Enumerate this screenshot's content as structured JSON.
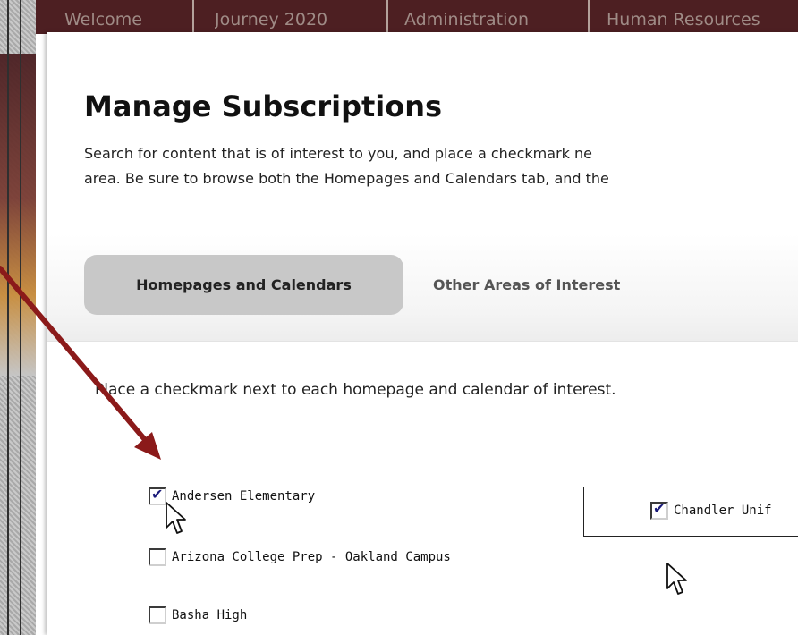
{
  "background_tabs": [
    "Welcome",
    "Journey 2020",
    "Administration",
    "Human Resources"
  ],
  "modal": {
    "title": "Manage Subscriptions",
    "description_line1": "Search for content that is of interest to you, and place a checkmark ne",
    "description_line2": "area. Be sure to browse both the Homepages and Calendars tab, and the",
    "tabs": {
      "active_label": "Homepages and Calendars",
      "other_label": "Other Areas of Interest"
    },
    "instruction": "Place a checkmark next to each homepage and calendar of interest.",
    "items": [
      {
        "label": "Andersen Elementary",
        "checked": true
      },
      {
        "label": "Arizona College Prep - Oakland Campus",
        "checked": false
      },
      {
        "label": "Basha High",
        "checked": false
      }
    ],
    "callout_item": {
      "label": "Chandler Unif",
      "checked": true
    }
  },
  "colors": {
    "arrow": "#8b1a1a",
    "tabbar": "#4d1f22",
    "active_tab": "#c8c8c8"
  },
  "icons": {
    "check": "✔"
  }
}
